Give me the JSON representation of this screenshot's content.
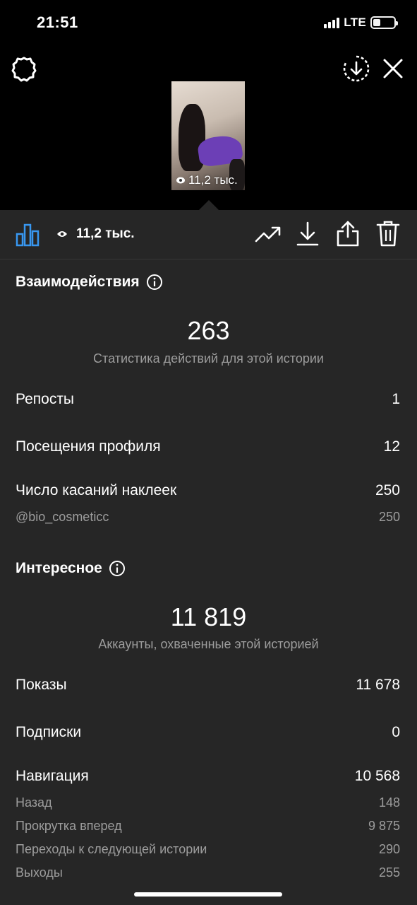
{
  "status_bar": {
    "time": "21:51",
    "network": "LTE",
    "battery_level": 0.35
  },
  "thumbnail": {
    "views": "11,2 тыс."
  },
  "toolbar": {
    "views": "11,2 тыс."
  },
  "interactions": {
    "title": "Взаимодействия",
    "total": "263",
    "subtitle": "Статистика действий для этой истории",
    "rows": [
      {
        "label": "Репосты",
        "value": "1"
      },
      {
        "label": "Посещения профиля",
        "value": "12"
      },
      {
        "label": "Число касаний наклеек",
        "value": "250"
      }
    ],
    "sticker": {
      "label": "@bio_cosmeticc",
      "value": "250"
    }
  },
  "discovery": {
    "title": "Интересное",
    "total": "11 819",
    "subtitle": "Аккаунты, охваченные этой историей",
    "rows": [
      {
        "label": "Показы",
        "value": "11 678"
      },
      {
        "label": "Подписки",
        "value": "0"
      },
      {
        "label": "Навигация",
        "value": "10 568"
      }
    ],
    "navigation": [
      {
        "label": "Назад",
        "value": "148"
      },
      {
        "label": "Прокрутка вперед",
        "value": "9 875"
      },
      {
        "label": "Переходы к следующей истории",
        "value": "290"
      },
      {
        "label": "Выходы",
        "value": "255"
      }
    ]
  },
  "colors": {
    "accent": "#3897f0",
    "background": "#262626",
    "muted_text": "#9d9d9d"
  }
}
